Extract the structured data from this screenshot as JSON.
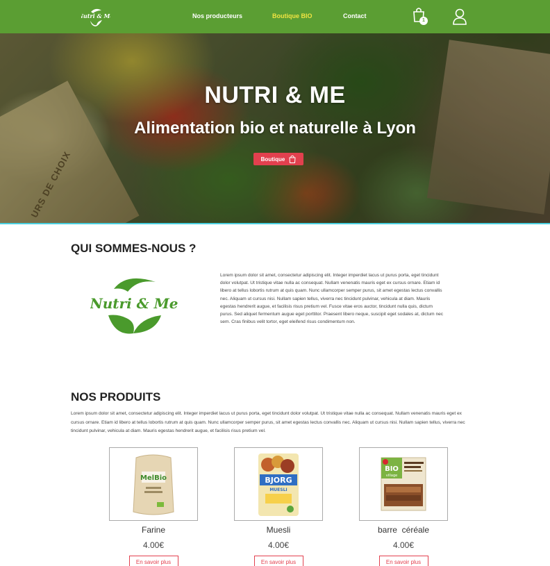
{
  "nav": {
    "logo_text": "Nutri & Me",
    "links": [
      "Nos producteurs",
      "Boutique BIO",
      "Contact"
    ],
    "cart_count": "1",
    "active_color": "#f0e442",
    "background": "#5b9e33"
  },
  "hero": {
    "title": "NUTRI & ME",
    "subtitle": "Alimentation bio et naturelle à Lyon",
    "button_label": "Boutique",
    "paper_text": "URS DE CHOIX",
    "button_color": "#e2404e"
  },
  "about": {
    "title": "QUI SOMMES-NOUS ?",
    "logo_text": "Nutri & Me",
    "text": "Lorem ipsum dolor sit amet, consectetur adipiscing elit. Integer imperdiet lacus ut purus porta, eget tincidunt dolor volutpat. Ut tristique vitae nulla ac consequat. Nullam venenatis mauris eget ex cursus ornare. Etiam id libero at tellus lobortis rutrum at quis quam. Nunc ullamcorper semper purus, sit amet egestas lectus convallis nec. Aliquam ut cursus nisi. Nullam sapien tellus, viverra nec tincidunt pulvinar, vehicula at diam. Mauris egestas hendrerit augue, et facilisis risus pretium vel. Fusce vitae eros auctor, tincidunt nulla quis, dictum purus. Sed aliquet fermentum augue eget porttitor. Praesent libero neque, suscipit eget sodales at, dictum nec sem. Cras finibus velit tortor, eget eleifend risus condimentum non."
  },
  "products": {
    "title": "NOS PRODUITS",
    "intro": "Lorem ipsum dolor sit amet, consectetur adipiscing elit. Integer imperdiet lacus ut purus porta, eget tincidunt dolor volutpat. Ut tristique vitae nulla ac consequat. Nullam venenatis mauris  eget ex cursus ornare. Etiam id libero at tellus lobortis rutrum at quis quam. Nunc ullamcorper  semper purus, sit amet egestas lectus convallis nec. Aliquam ut cursus nisi. Nullam sapien tellus, viverra nec tincidunt pulvinar, vehicula at diam. Mauris egestas hendrerit augue, et facilisis risus pretium vel.",
    "items": [
      {
        "name": "Farine",
        "price": "4.00€",
        "button": "En savoir plus",
        "package_label": "MelBio"
      },
      {
        "name": "Muesli",
        "price": "4.00€",
        "button": "En savoir plus",
        "package_label": "BJORG",
        "package_sublabel": "MUESLI"
      },
      {
        "name": "barre  céréale",
        "price": "4.00€",
        "button": "En savoir plus",
        "package_label": "BIO",
        "package_sublabel": "village"
      }
    ]
  }
}
